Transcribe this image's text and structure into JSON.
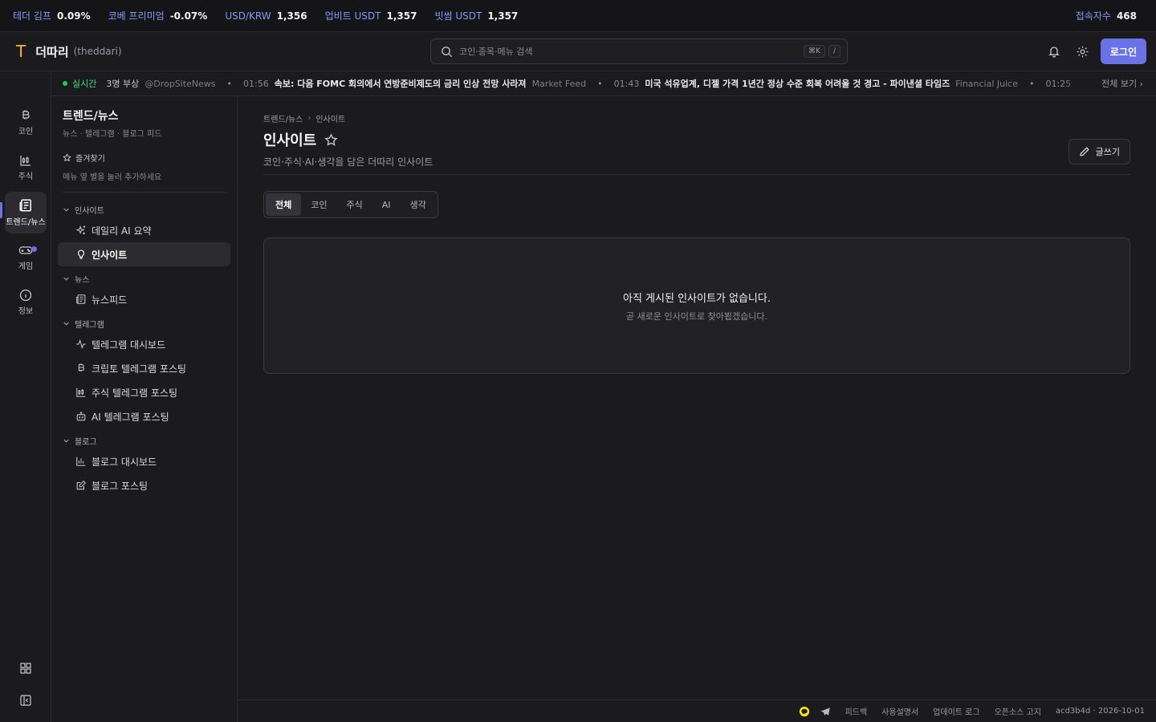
{
  "ticker": [
    {
      "label": "테더 김프",
      "value": "0.09%"
    },
    {
      "label": "코베 프리미엄",
      "value": "-0.07%"
    },
    {
      "label": "USD/KRW",
      "value": "1,356"
    },
    {
      "label": "업비트 USDT",
      "value": "1,357"
    },
    {
      "label": "빗썸 USDT",
      "value": "1,357"
    }
  ],
  "users": {
    "label": "접속자수",
    "value": "468"
  },
  "header": {
    "logo_letter": "T",
    "app_name": "더따리",
    "app_handle": "(theddari)",
    "search_placeholder": "코인·종목·메뉴 검색",
    "kbd_cmd": "⌘K",
    "kbd_slash": "/",
    "login_label": "로그인"
  },
  "news": {
    "live_label": "실시간",
    "items": [
      {
        "time": "",
        "title": "3명 부상",
        "source": "@DropSiteNews"
      },
      {
        "time": "01:56",
        "title": "속보: 다음 FOMC 회의에서 연방준비제도의 금리 인상 전망 사라져",
        "source": "Market Feed"
      },
      {
        "time": "01:43",
        "title": "미국 석유업계, 디젤 가격 1년간 정상 수준 회복 어려울 것 경고 - 파이낸셜 타임즈",
        "source": "Financial Juice"
      },
      {
        "time": "01:25",
        "title": "",
        "source": ""
      }
    ],
    "see_all": "전체 보기 ›"
  },
  "rail": {
    "coin": "코인",
    "stock": "주식",
    "trends": "트렌드/뉴스",
    "game": "게임",
    "info": "정보"
  },
  "sidenav": {
    "title": "트렌드/뉴스",
    "subtitle": "뉴스 · 텔레그램 · 블로그 피드",
    "favorites_title": "즐겨찾기",
    "favorites_hint": "메뉴 옆 별을 눌러 추가하세요",
    "groups": {
      "insight": "인사이트",
      "news": "뉴스",
      "telegram": "텔레그램",
      "blog": "블로그"
    },
    "items": {
      "daily_ai": "데일리 AI 요약",
      "insight": "인사이트",
      "newsfeed": "뉴스피드",
      "tg_dashboard": "텔레그램 대시보드",
      "tg_crypto": "크립토 텔레그램 포스팅",
      "tg_stock": "주식 텔레그램 포스팅",
      "tg_ai": "AI 텔레그램 포스팅",
      "blog_dashboard": "블로그 대시보드",
      "blog_posting": "블로그 포스팅"
    }
  },
  "main": {
    "breadcrumb": [
      "트렌드/뉴스",
      "인사이트"
    ],
    "title": "인사이트",
    "subtitle": "코인·주식·AI·생각을 담은 더따리 인사이트",
    "write_label": "글쓰기",
    "tabs": [
      "전체",
      "코인",
      "주식",
      "AI",
      "생각"
    ],
    "active_tab": "전체",
    "empty_title": "아직 게시된 인사이트가 없습니다.",
    "empty_sub": "곧 새로운 인사이트로 찾아뵙겠습니다."
  },
  "footer": {
    "feedback": "피드백",
    "terms": "사용설명서",
    "changelog": "업데이트 로그",
    "oss": "오픈소스 고지",
    "version": "acd3b4d · 2026-10-01"
  },
  "colors": {
    "accent": "#6b72e8",
    "live": "#22c55e",
    "logo": "#f2b62b",
    "kakao": "#f7e600"
  }
}
